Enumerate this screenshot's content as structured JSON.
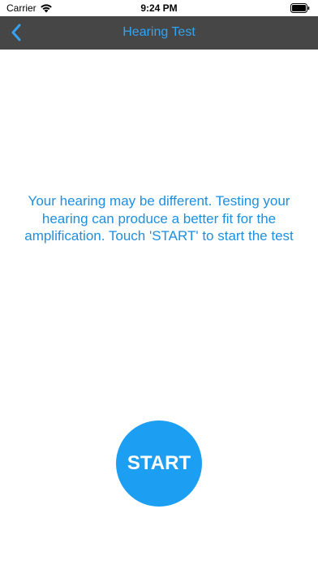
{
  "status_bar": {
    "carrier": "Carrier",
    "time": "9:24 PM",
    "wifi_icon": "wifi-icon",
    "battery_icon": "battery-icon"
  },
  "nav": {
    "title": "Hearing Test",
    "back_icon": "chevron-left-icon",
    "bar_color": "#464646",
    "accent_color": "#35a3f0"
  },
  "main": {
    "instructions": "Your hearing may be different. Testing your hearing can produce a better fit for the amplification. Touch 'START' to start the test",
    "start_label": "START",
    "button_color": "#1c9ff3"
  }
}
